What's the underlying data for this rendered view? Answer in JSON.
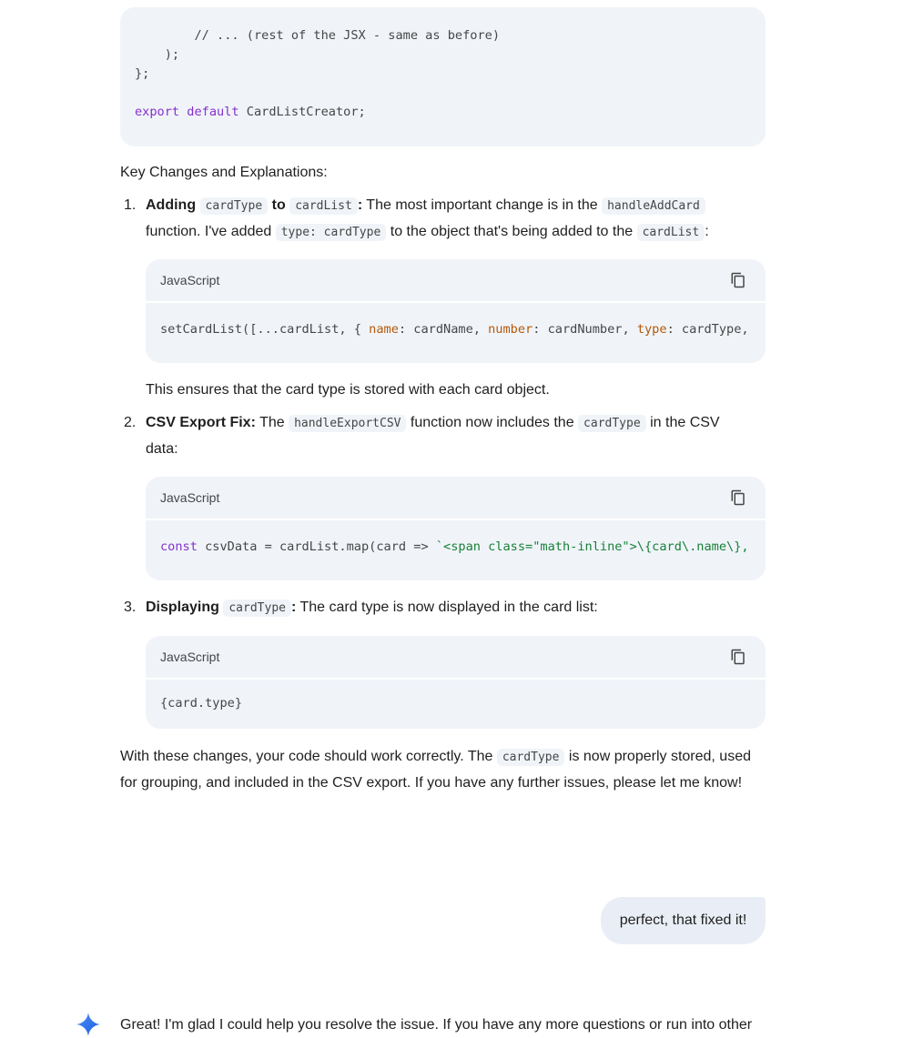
{
  "top_code": {
    "line1": "        // ... (rest of the JSX - same as before)",
    "line2": "    );",
    "line3": "};",
    "line4_kw1": "export",
    "line4_kw2": "default",
    "line4_rest": " CardListCreator;"
  },
  "heading": "Key Changes and Explanations:",
  "item1": {
    "number": "1.",
    "bold_a": "Adding",
    "code_a": "cardType",
    "bold_b": "to",
    "code_b": "cardList",
    "bold_c": ":",
    "text_a": " The most important change is in the ",
    "code_c": "handleAddCard",
    "text_b": "function. I've added ",
    "code_d": "type: cardType",
    "text_c": " to the object that's being added to the ",
    "code_e": "cardList",
    "text_d": ":",
    "lang": "JavaScript",
    "code": {
      "p1": "setCardList([...cardList, { ",
      "k1": "name",
      "p2": ": cardName, ",
      "k2": "number",
      "p3": ": cardNumber, ",
      "k3": "type",
      "p4": ": cardType,"
    },
    "after": "This ensures that the card type is stored with each card object."
  },
  "item2": {
    "number": "2.",
    "bold": "CSV Export Fix:",
    "text_a": " The ",
    "code_a": "handleExportCSV",
    "text_b": " function now includes the ",
    "code_b": "cardType",
    "text_c": " in the CSV",
    "text_d": "data:",
    "lang": "JavaScript",
    "code": {
      "kw": "const",
      "p1": " csvData = cardList.map(card => ",
      "s1": "`<span class=\"math-inline\">\\{card\\.name\\},"
    }
  },
  "item3": {
    "number": "3.",
    "bold": "Displaying",
    "code_a": "cardType",
    "bold_b": ":",
    "text": " The card type is now displayed in the card list:",
    "lang": "JavaScript",
    "code": "{card.type}"
  },
  "closing": {
    "text_a": "With these changes, your code should work correctly. The ",
    "code": "cardType",
    "text_b": " is now properly stored, used for grouping, and included in the CSV export.  If you have any further issues, please let me know!"
  },
  "user_message": "perfect, that fixed it!",
  "reply": "Great! I'm glad I could help you resolve the issue. If you have any more questions or run into other",
  "icons": {
    "copy": "copy-icon",
    "gemini": "gemini-sparkle-icon"
  },
  "colors": {
    "code_bg": "#f0f4f9",
    "keyword": "#8430ce",
    "property": "#b55908",
    "string": "#188038",
    "user_bubble": "#e9eef6",
    "gemini_blue": "#4285f4"
  }
}
